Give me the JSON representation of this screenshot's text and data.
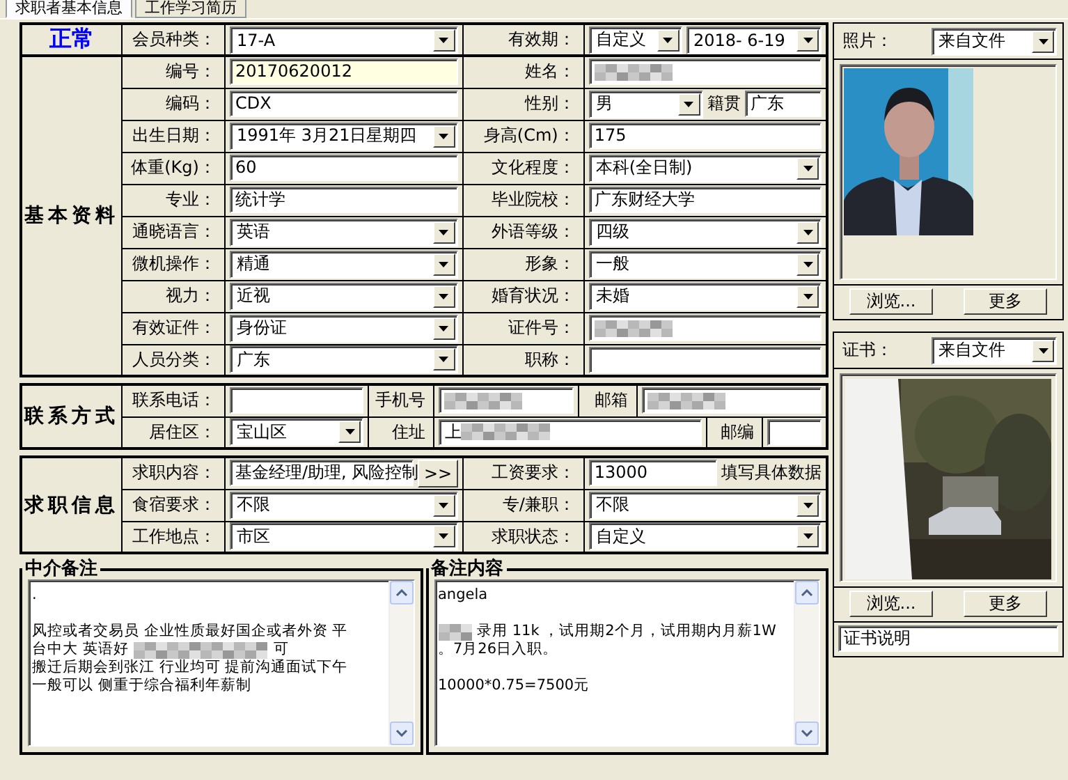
{
  "tabs": [
    {
      "label": "求职者基本信息",
      "selected": true
    },
    {
      "label": "工作学习简历",
      "selected": false
    }
  ],
  "basic": {
    "status": "正常",
    "title": "基本资料",
    "header": [
      {
        "label": "会员种类：",
        "fields": [
          {
            "kind": "combo",
            "value": "17-A"
          }
        ]
      },
      {
        "label": "有效期：",
        "fields": [
          {
            "kind": "combo",
            "value": "自定义"
          },
          {
            "kind": "combo",
            "value": "2018- 6-19"
          }
        ]
      }
    ],
    "rows": [
      [
        {
          "label": "编号：",
          "fields": [
            {
              "kind": "text",
              "value": "20170620012",
              "highlighted": true
            }
          ]
        },
        {
          "label": "姓名：",
          "fields": [
            {
              "kind": "redacted"
            }
          ]
        }
      ],
      [
        {
          "label": "编码：",
          "fields": [
            {
              "kind": "text",
              "value": "CDX",
              "highlighted": false
            }
          ]
        },
        {
          "label": "性别：",
          "fields": [
            {
              "kind": "combo",
              "value": "男"
            },
            {
              "kind": "label",
              "value": "籍贯"
            },
            {
              "kind": "text",
              "value": "广东",
              "highlighted": false
            }
          ]
        }
      ],
      [
        {
          "label": "出生日期：",
          "fields": [
            {
              "kind": "combo",
              "value": "1991年 3月21日星期四"
            }
          ]
        },
        {
          "label": "身高(Cm)：",
          "fields": [
            {
              "kind": "text",
              "value": "175",
              "highlighted": false
            }
          ]
        }
      ],
      [
        {
          "label": "体重(Kg)：",
          "fields": [
            {
              "kind": "text",
              "value": "60",
              "highlighted": false
            }
          ]
        },
        {
          "label": "文化程度：",
          "fields": [
            {
              "kind": "combo",
              "value": "本科(全日制)"
            }
          ]
        }
      ],
      [
        {
          "label": "专业：",
          "fields": [
            {
              "kind": "text",
              "value": "统计学",
              "highlighted": false
            }
          ]
        },
        {
          "label": "毕业院校：",
          "fields": [
            {
              "kind": "text",
              "value": "广东财经大学",
              "highlighted": false
            }
          ]
        }
      ],
      [
        {
          "label": "通晓语言：",
          "fields": [
            {
              "kind": "combo",
              "value": "英语"
            }
          ]
        },
        {
          "label": "外语等级：",
          "fields": [
            {
              "kind": "combo",
              "value": "四级"
            }
          ]
        }
      ],
      [
        {
          "label": "微机操作：",
          "fields": [
            {
              "kind": "combo",
              "value": "精通"
            }
          ]
        },
        {
          "label": "形象：",
          "fields": [
            {
              "kind": "combo",
              "value": "一般"
            }
          ]
        }
      ],
      [
        {
          "label": "视力：",
          "fields": [
            {
              "kind": "combo",
              "value": "近视"
            }
          ]
        },
        {
          "label": "婚育状况：",
          "fields": [
            {
              "kind": "combo",
              "value": "未婚"
            }
          ]
        }
      ],
      [
        {
          "label": "有效证件：",
          "fields": [
            {
              "kind": "combo",
              "value": "身份证"
            }
          ]
        },
        {
          "label": "证件号：",
          "fields": [
            {
              "kind": "redacted"
            }
          ]
        }
      ],
      [
        {
          "label": "人员分类：",
          "fields": [
            {
              "kind": "combo",
              "value": "广东"
            }
          ]
        },
        {
          "label": "职称：",
          "fields": [
            {
              "kind": "text",
              "highlighted": false
            }
          ]
        }
      ]
    ]
  },
  "contact": {
    "title": "联系方式",
    "rows": [
      [
        {
          "label": "联系电话：",
          "fields": [
            {
              "kind": "text",
              "highlighted": false
            }
          ]
        },
        {
          "label": "手机号",
          "fields": [
            {
              "kind": "redacted"
            }
          ]
        },
        {
          "label": "邮箱",
          "fields": [
            {
              "kind": "redacted"
            }
          ]
        }
      ],
      [
        {
          "label": "居住区：",
          "fields": [
            {
              "kind": "combo",
              "value": "宝山区"
            }
          ]
        },
        {
          "label": "住址",
          "fields": [
            {
              "kind": "redacted",
              "value": "上"
            }
          ]
        },
        {
          "label": "邮编",
          "fields": [
            {
              "kind": "text",
              "highlighted": false
            }
          ]
        }
      ]
    ]
  },
  "job": {
    "title": "求职信息",
    "rows": [
      [
        {
          "label": "求职内容：",
          "fields": [
            {
              "kind": "text",
              "value": "基金经理/助理, 风险控制",
              "highlighted": false
            },
            {
              "kind": "button",
              "value": ">>"
            }
          ]
        },
        {
          "label": "工资要求：",
          "fields": [
            {
              "kind": "text",
              "value": "13000",
              "highlighted": false
            },
            {
              "kind": "note",
              "value": "填写具体数据"
            }
          ]
        }
      ],
      [
        {
          "label": "食宿要求：",
          "fields": [
            {
              "kind": "combo",
              "value": "不限"
            }
          ]
        },
        {
          "label": "专/兼职：",
          "fields": [
            {
              "kind": "combo",
              "value": "不限"
            }
          ]
        }
      ],
      [
        {
          "label": "工作地点：",
          "fields": [
            {
              "kind": "combo",
              "value": "市区"
            }
          ]
        },
        {
          "label": "求职状态：",
          "fields": [
            {
              "kind": "combo",
              "value": "自定义"
            }
          ]
        }
      ]
    ]
  },
  "notes": [
    {
      "title": "中介备注",
      "lines": [
        {
          "kind": "text",
          "segments": [
            {
              "kind": "text",
              "text": "."
            }
          ]
        },
        {
          "kind": "blank"
        },
        {
          "kind": "text",
          "segments": [
            {
              "kind": "text",
              "text": "风控或者交易员 企业性质最好国企或者外资 平"
            }
          ]
        },
        {
          "kind": "text",
          "segments": [
            {
              "kind": "text",
              "text": "台中大 英语好"
            },
            {
              "kind": "redacted"
            },
            {
              "kind": "text",
              "text": "可"
            }
          ]
        },
        {
          "kind": "text",
          "segments": [
            {
              "kind": "text",
              "text": "搬迁后期会到张江 行业均可 提前沟通面试下午"
            }
          ]
        },
        {
          "kind": "text",
          "segments": [
            {
              "kind": "text",
              "text": "一般可以 侧重于综合福利年薪制"
            }
          ]
        }
      ]
    },
    {
      "title": "备注内容",
      "lines": [
        {
          "kind": "text",
          "segments": [
            {
              "kind": "text",
              "text": "angela"
            }
          ]
        },
        {
          "kind": "blank"
        },
        {
          "kind": "text",
          "segments": [
            {
              "kind": "redacted"
            },
            {
              "kind": "text",
              "text": "录用 11k ，试用期2个月，试用期内月薪1W"
            }
          ]
        },
        {
          "kind": "text",
          "segments": [
            {
              "kind": "text",
              "text": "。7月26日入职。"
            }
          ]
        },
        {
          "kind": "blank"
        },
        {
          "kind": "text",
          "segments": [
            {
              "kind": "text",
              "text": "10000*0.75=7500元"
            }
          ]
        }
      ]
    }
  ],
  "media": [
    {
      "label": "照片：",
      "source": {
        "kind": "combo",
        "value": "来自文件"
      },
      "buttons": [
        "浏览...",
        "更多"
      ]
    },
    {
      "label": "证书：",
      "source": {
        "kind": "combo",
        "value": "来自文件"
      },
      "buttons": [
        "浏览...",
        "更多"
      ],
      "caption": {
        "kind": "text",
        "value": "证书说明",
        "highlighted": false
      }
    }
  ]
}
